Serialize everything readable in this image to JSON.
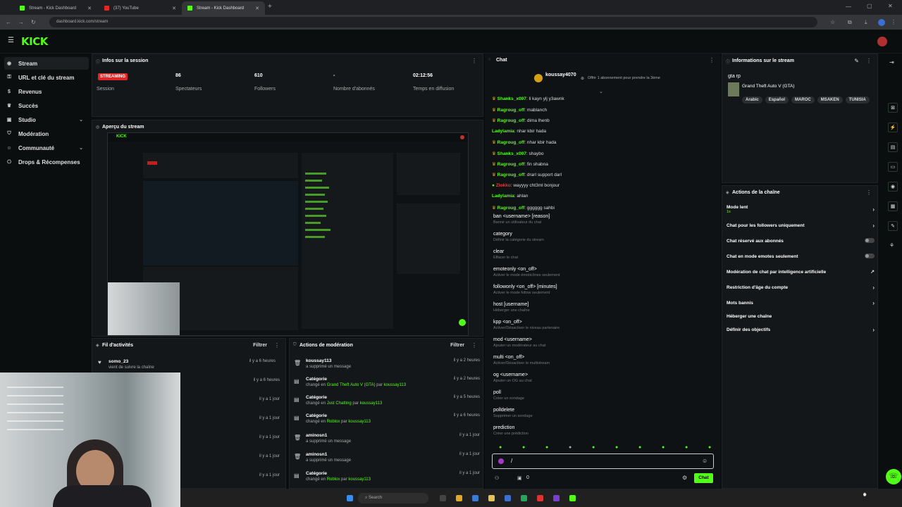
{
  "browser": {
    "tabs": [
      {
        "title": "Stream - Kick Dashboard"
      },
      {
        "title": "(37) YouTube"
      },
      {
        "title": "Stream - Kick Dashboard"
      }
    ],
    "url": "dashboard.kick.com/stream",
    "new_tab": "+"
  },
  "header": {
    "logo": "KICK",
    "menu_icon": "hamburger-icon"
  },
  "sidebar": {
    "items": [
      {
        "label": "Stream",
        "icon": "stream-icon",
        "active": true
      },
      {
        "label": "URL et clé du stream",
        "icon": "key-icon"
      },
      {
        "label": "Revenus",
        "icon": "money-icon"
      },
      {
        "label": "Succès",
        "icon": "trophy-icon"
      },
      {
        "label": "Studio",
        "icon": "studio-icon",
        "expandable": true
      },
      {
        "label": "Modération",
        "icon": "shield-icon"
      },
      {
        "label": "Communauté",
        "icon": "community-icon",
        "expandable": true
      },
      {
        "label": "Drops & Récompenses",
        "icon": "gift-icon"
      }
    ]
  },
  "session": {
    "title": "Infos sur la session",
    "badge": "STREAMING",
    "badge_label": "Session",
    "stats": [
      {
        "value": "86",
        "label": "Spectateurs"
      },
      {
        "value": "610",
        "label": "Followers"
      },
      {
        "value": "-",
        "label": "Nombre d'abonnés"
      },
      {
        "value": "02:12:56",
        "label": "Temps en diffusion"
      }
    ]
  },
  "preview": {
    "title": "Aperçu du stream"
  },
  "activity": {
    "title": "Fil d'activités",
    "filter": "Filtrer",
    "rows": [
      {
        "name": "somo_23",
        "sub": "vient de suivre la chaîne",
        "time": "il y a 6 heures"
      },
      {
        "name": "",
        "sub": "",
        "time": "il y a 6 heures"
      },
      {
        "name": "",
        "sub": "",
        "time": "il y a 1 jour"
      },
      {
        "name": "",
        "sub": "",
        "time": "il y a 1 jour"
      },
      {
        "name": "",
        "sub": "",
        "time": "il y a 1 jour"
      },
      {
        "name": "",
        "sub": "",
        "time": "il y a 1 jour"
      },
      {
        "name": "",
        "sub": "",
        "time": "il y a 1 jour"
      }
    ]
  },
  "moderation": {
    "title": "Actions de modération",
    "filter": "Filtrer",
    "rows": [
      {
        "name": "koussay113",
        "pre": "a supprimé un message",
        "hl": "",
        "post": "",
        "who": "",
        "time": "il y a 2 heures"
      },
      {
        "name": "Catégorie",
        "pre": "changé en ",
        "hl": "Grand Theft Auto V (GTA)",
        "post": " par ",
        "who": "koussay113",
        "time": "il y a 2 heures"
      },
      {
        "name": "Catégorie",
        "pre": "changé en ",
        "hl": "Just Chatting",
        "post": " par ",
        "who": "koussay113",
        "time": "il y a 5 heures"
      },
      {
        "name": "Catégorie",
        "pre": "changé en ",
        "hl": "Roblox",
        "post": " par ",
        "who": "koussay113",
        "time": "il y a 6 heures"
      },
      {
        "name": "aminosn1",
        "pre": "a supprimé un message",
        "hl": "",
        "post": "",
        "who": "",
        "time": "il y a 1 jour"
      },
      {
        "name": "aminosn1",
        "pre": "a supprimé un message",
        "hl": "",
        "post": "",
        "who": "",
        "time": "il y a 1 jour"
      },
      {
        "name": "Catégorie",
        "pre": "changé en ",
        "hl": "Roblox",
        "post": " par ",
        "who": "koussay113",
        "time": "il y a 1 jour"
      }
    ]
  },
  "chat": {
    "title": "Chat",
    "pinned_user": "koussay4070",
    "pinned_text": "Offrir 1 abonnement pour prendre la 3ème",
    "messages": [
      {
        "user": "Shanks_x007",
        "text": "li kayn ylj y3awnk",
        "color": "#53fc18"
      },
      {
        "user": "Ragroug_off",
        "text": "mablanch",
        "color": "#53fc18"
      },
      {
        "user": "Ragroug_off",
        "text": "dima lhenb",
        "color": "#53fc18"
      },
      {
        "user": "Ladylamia",
        "text": "nhar kbir hada",
        "color": "#53fc18"
      },
      {
        "user": "Ragroug_off",
        "text": "nhar kbir hada",
        "color": "#53fc18"
      },
      {
        "user": "Shanks_x007",
        "text": "shaybo",
        "color": "#53fc18"
      },
      {
        "user": "Ragroug_off",
        "text": "fin shabna",
        "color": "#53fc18"
      },
      {
        "user": "Ragroug_off",
        "text": "drarl support darl",
        "color": "#53fc18"
      },
      {
        "user": "Zlokko",
        "text": "wayyyy cht3ml bonjour",
        "color": "#e03c3c"
      },
      {
        "user": "Ladylamia",
        "text": "ahlan",
        "color": "#53fc18"
      },
      {
        "user": "Ragroug_off",
        "text": "gggggg sahbi",
        "color": "#53fc18"
      }
    ],
    "commands": [
      {
        "cmd": "ban <username> [reason]",
        "desc": "Bannir un utilisateur du chat"
      },
      {
        "cmd": "category",
        "desc": "Définir la catégorie du stream"
      },
      {
        "cmd": "clear",
        "desc": "Effacer le chat"
      },
      {
        "cmd": "emoteonly <on_off>",
        "desc": "Activer le mode émoticônes seulement"
      },
      {
        "cmd": "followonly <on_off> [minutes]",
        "desc": "Activer le mode follow seulement"
      },
      {
        "cmd": "host [username]",
        "desc": "Héberger une chaîne"
      },
      {
        "cmd": "kpp <on_off>",
        "desc": "Activer/Désactiver le niveau partenaire"
      },
      {
        "cmd": "mod <username>",
        "desc": "Ajouter un modérateur au chat"
      },
      {
        "cmd": "multi <on_off>",
        "desc": "Activer/Désactiver le multistream"
      },
      {
        "cmd": "og <username>",
        "desc": "Ajouter un OG au chat"
      },
      {
        "cmd": "poll",
        "desc": "Créer un sondage"
      },
      {
        "cmd": "polldelete",
        "desc": "Supprimer un sondage"
      },
      {
        "cmd": "prediction",
        "desc": "Créer une prédiction"
      }
    ],
    "input_value": "/",
    "viewer_count": "0",
    "send_label": "Chat"
  },
  "stream_info": {
    "title": "Informations sur le stream",
    "stream_title": "gta rp",
    "category": "Grand Theft Auto V (GTA)",
    "tags": [
      "Arabic",
      "Español",
      "MAROC",
      "MSAKEN",
      "TUNISIA"
    ]
  },
  "channel_actions": {
    "title": "Actions de la chaîne",
    "items": [
      {
        "label": "Mode lent",
        "sub": "1s",
        "control": "arrow"
      },
      {
        "label": "Chat pour les followers uniquement",
        "control": "arrow"
      },
      {
        "label": "Chat réservé aux abonnés",
        "control": "toggle"
      },
      {
        "label": "Chat en mode emotes seulement",
        "control": "toggle"
      },
      {
        "label": "Modération de chat par intelligence artificielle",
        "control": "external"
      },
      {
        "label": "Restriction d'âge du compte",
        "control": "arrow"
      },
      {
        "label": "Mots bannis",
        "control": "arrow"
      },
      {
        "label": "Héberger une chaîne",
        "control": "none"
      },
      {
        "label": "Définir des objectifs",
        "control": "arrow"
      }
    ]
  },
  "taskbar": {
    "search_placeholder": "Search"
  },
  "colors": {
    "kick_green": "#53fc18",
    "live_red": "#e02626",
    "panel": "#141719",
    "bg": "#0b0e0f"
  }
}
